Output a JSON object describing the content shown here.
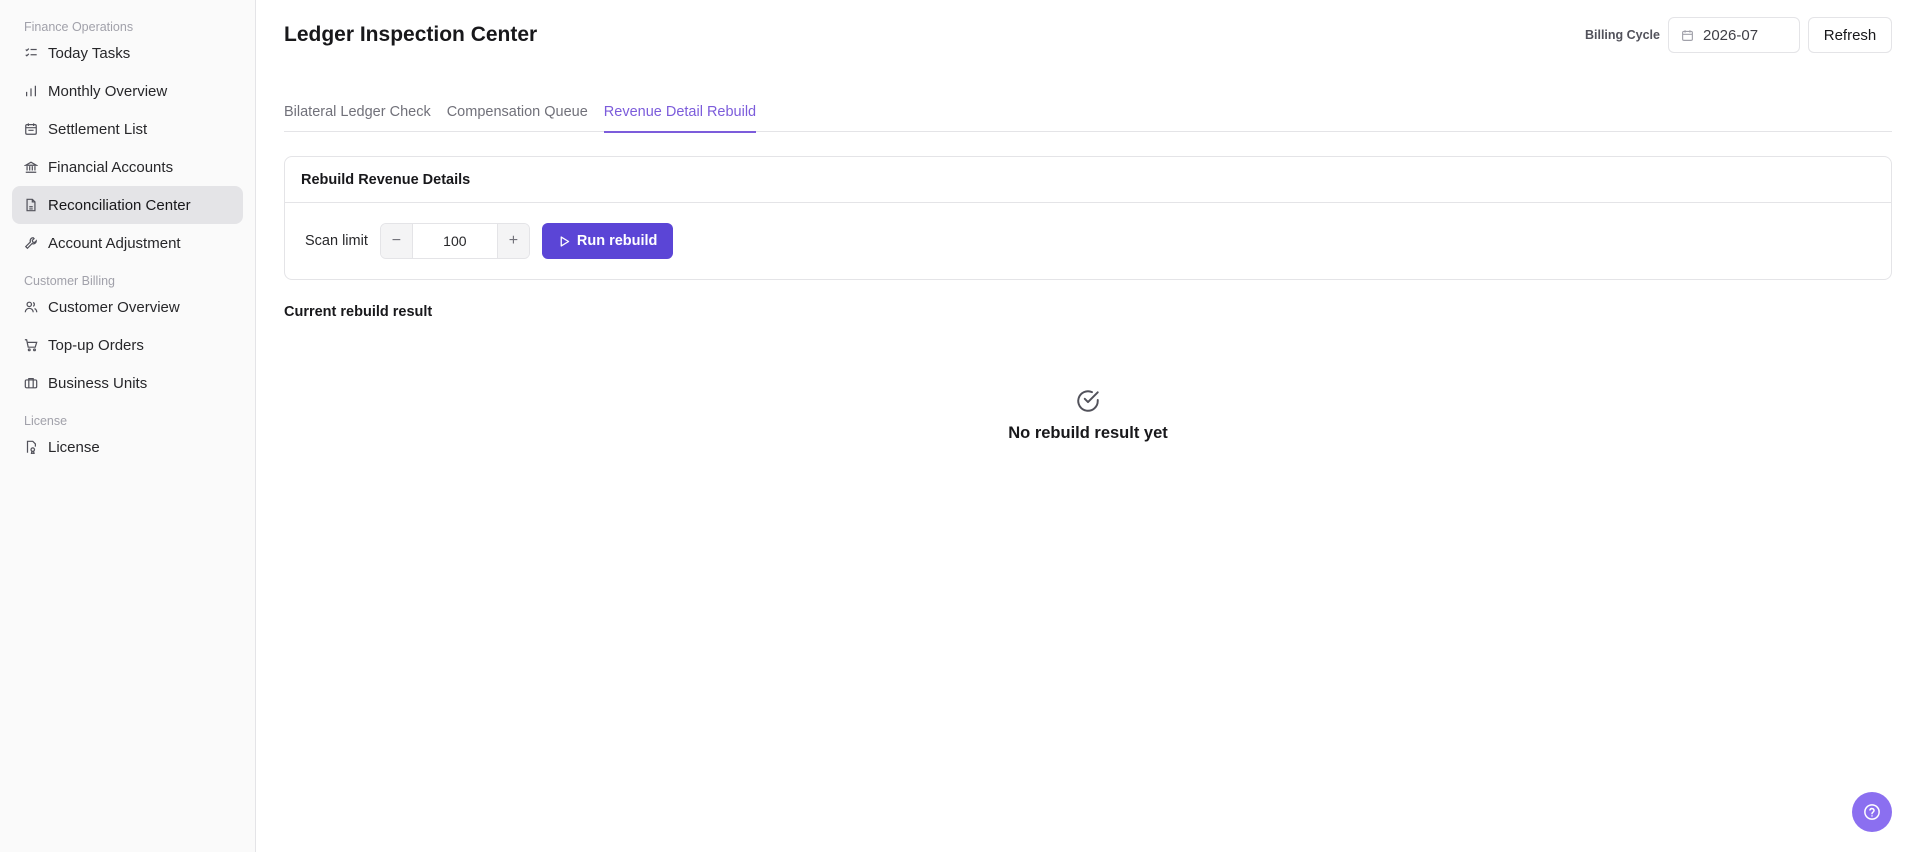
{
  "sidebar": {
    "groups": [
      {
        "label": "Finance Operations",
        "items": [
          {
            "label": "Today Tasks",
            "icon": "list-check-icon"
          },
          {
            "label": "Monthly Overview",
            "icon": "bar-chart-icon"
          },
          {
            "label": "Settlement List",
            "icon": "calendar-list-icon"
          },
          {
            "label": "Financial Accounts",
            "icon": "bank-icon"
          },
          {
            "label": "Reconciliation Center",
            "icon": "file-check-icon",
            "active": true
          },
          {
            "label": "Account Adjustment",
            "icon": "wrench-icon"
          }
        ]
      },
      {
        "label": "Customer Billing",
        "items": [
          {
            "label": "Customer Overview",
            "icon": "users-icon"
          },
          {
            "label": "Top-up Orders",
            "icon": "cart-icon"
          },
          {
            "label": "Business Units",
            "icon": "briefcase-icon"
          }
        ]
      },
      {
        "label": "License",
        "items": [
          {
            "label": "License",
            "icon": "license-icon"
          }
        ]
      }
    ]
  },
  "header": {
    "title": "Ledger Inspection Center",
    "billing_label": "Billing Cycle",
    "billing_value": "2026-07",
    "refresh_label": "Refresh"
  },
  "tabs": [
    {
      "label": "Bilateral Ledger Check"
    },
    {
      "label": "Compensation Queue"
    },
    {
      "label": "Revenue Detail Rebuild",
      "active": true
    }
  ],
  "rebuild_card": {
    "title": "Rebuild Revenue Details",
    "scan_label": "Scan limit",
    "scan_value": "100",
    "minus_symbol": "−",
    "plus_symbol": "+",
    "run_label": "Run rebuild"
  },
  "result": {
    "title": "Current rebuild result",
    "empty_text": "No rebuild result yet"
  },
  "colors": {
    "accent": "#5b45d6",
    "tab_active": "#7c5cdb",
    "help_button": "#8b6ff0",
    "active_nav_bg": "#e4e4e7"
  }
}
